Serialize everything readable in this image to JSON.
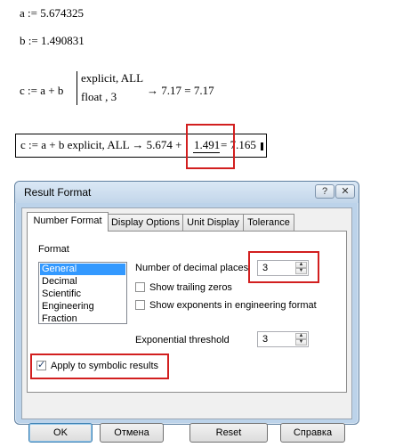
{
  "worksheet": {
    "line_a": "a := 5.674325",
    "line_b": "b := 1.490831",
    "line_c": "c := a + b",
    "keyword1": "explicit, ALL",
    "keyword2": "float , 3",
    "result1": "→ 7.17 = 7.17",
    "eval_lhs": "c := a + b  explicit, ALL  → 5.674 +",
    "eval_mid": "1.491",
    "eval_rhs": "= 7.165"
  },
  "dialog": {
    "title": "Result Format",
    "help_glyph": "?",
    "close_glyph": "✕",
    "tabs": [
      "Number Format",
      "Display Options",
      "Unit Display",
      "Tolerance"
    ],
    "format_label": "Format",
    "format_options": [
      "General",
      "Decimal",
      "Scientific",
      "Engineering",
      "Fraction"
    ],
    "selected_format": "General",
    "decimal_places_label": "Number of decimal places",
    "decimal_places_value": "3",
    "show_trailing_zeros_label": "Show trailing zeros",
    "show_exponents_label": "Show exponents in engineering format",
    "exp_threshold_label": "Exponential threshold",
    "exp_threshold_value": "3",
    "apply_symbolic_label": "Apply to symbolic results",
    "buttons": {
      "ok": "OK",
      "cancel": "Отмена",
      "reset": "Reset",
      "help": "Справка"
    }
  },
  "colors": {
    "highlight_box": "#d21f1f",
    "selection": "#3399ff",
    "dialog_frame": "#bcd3ea"
  }
}
